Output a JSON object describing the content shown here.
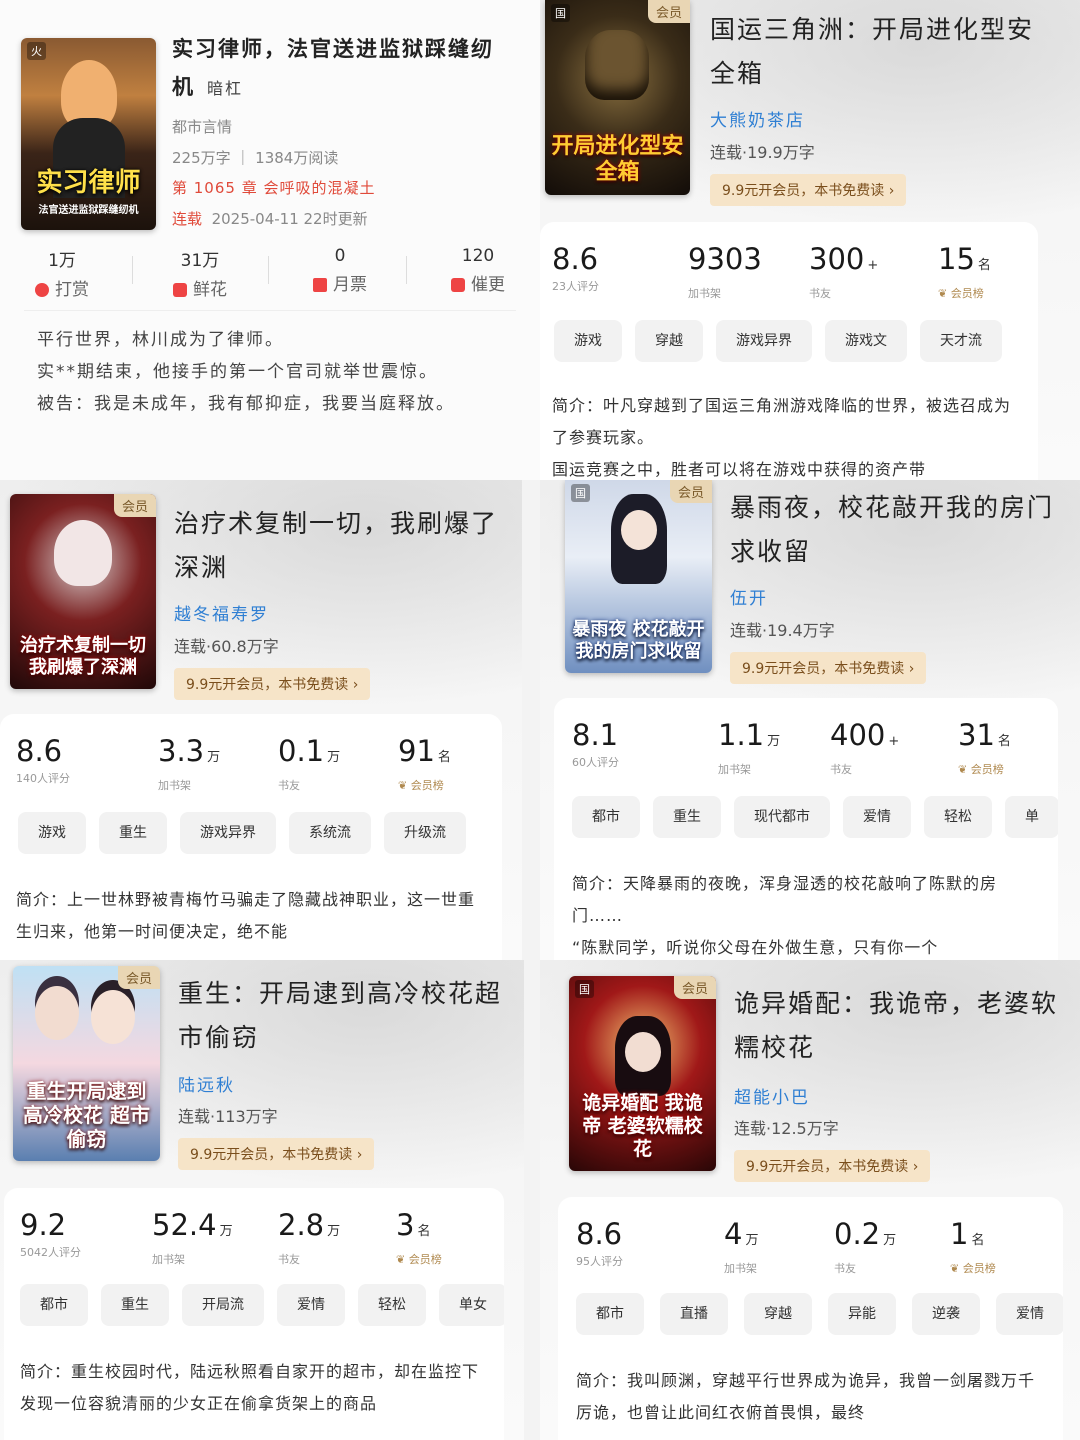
{
  "first": {
    "title": "实习律师，法官送进监狱踩缝纫机",
    "author": "暗杠",
    "genre": "都市言情",
    "words_reads": "225万字 ｜ 1384万阅读",
    "chapter": "第 1065 章 会呼吸的混凝土",
    "serial": "连载",
    "updated": "2025-04-11 22时更新",
    "cover_title": "实习律师",
    "cover_sub": "法官送进监狱踩缝纫机",
    "stats": [
      {
        "num": "1万",
        "label": "打赏"
      },
      {
        "num": "31万",
        "label": "鲜花"
      },
      {
        "num": "0",
        "label": "月票"
      },
      {
        "num": "120",
        "label": "催更"
      }
    ],
    "intro": [
      "平行世界，林川成为了律师。",
      "实**期结束，他接手的第一个官司就举世震惊。",
      "被告：我是未成年，我有郁抑症，我要当庭释放。"
    ]
  },
  "vip_label": "会员",
  "vip_button": "9.9元开会员，本书免费读",
  "rank_label": "会员榜",
  "intro_prefix": "简介：",
  "books": [
    {
      "title": "国运三角洲：开局进化型安全箱",
      "author": "大熊奶茶店",
      "meta": "连载·19.9万字",
      "cover_title": "开局进化型安全箱",
      "rating": "8.6",
      "rating_label": "23人评分",
      "shelf": "9303",
      "shelf_unit": "",
      "shelf_label": "加书架",
      "friends": "300",
      "friends_unit": "+",
      "friends_label": "书友",
      "rank": "15",
      "rank_unit": "名",
      "tags": [
        "游戏",
        "穿越",
        "游戏异界",
        "游戏文",
        "天才流"
      ],
      "intro": "叶凡穿越到了国运三角洲游戏降临的世界，被选召成为了参赛玩家。",
      "intro2": "国运竞赛之中，胜者可以将在游戏中获得的资产带"
    },
    {
      "title": "治疗术复制一切，我刷爆了深渊",
      "author": "越冬福寿罗",
      "meta": "连载·60.8万字",
      "cover_title": "治疗术复制一切我刷爆了深渊",
      "rating": "8.6",
      "rating_label": "140人评分",
      "shelf": "3.3",
      "shelf_unit": "万",
      "shelf_label": "加书架",
      "friends": "0.1",
      "friends_unit": "万",
      "friends_label": "书友",
      "rank": "91",
      "rank_unit": "名",
      "tags": [
        "游戏",
        "重生",
        "游戏异界",
        "系统流",
        "升级流"
      ],
      "intro": "上一世林野被青梅竹马骗走了隐藏战神职业，这一世重生归来，他第一时间便决定，绝不能",
      "intro2": ""
    },
    {
      "title": "暴雨夜，校花敲开我的房门求收留",
      "author": "伍开",
      "meta": "连载·19.4万字",
      "cover_title": "暴雨夜 校花敲开我的房门求收留",
      "rating": "8.1",
      "rating_label": "60人评分",
      "shelf": "1.1",
      "shelf_unit": "万",
      "shelf_label": "加书架",
      "friends": "400",
      "friends_unit": "+",
      "friends_label": "书友",
      "rank": "31",
      "rank_unit": "名",
      "tags": [
        "都市",
        "重生",
        "现代都市",
        "爱情",
        "轻松",
        "单"
      ],
      "intro": "天降暴雨的夜晚，浑身湿透的校花敲响了陈默的房门……",
      "intro2": "“陈默同学，听说你父母在外做生意，只有你一个"
    },
    {
      "title": "重生：开局逮到高冷校花超市偷窃",
      "author": "陆远秋",
      "meta": "连载·113万字",
      "cover_title": "重生开局逮到 高冷校花 超市偷窃",
      "rating": "9.2",
      "rating_label": "5042人评分",
      "shelf": "52.4",
      "shelf_unit": "万",
      "shelf_label": "加书架",
      "friends": "2.8",
      "friends_unit": "万",
      "friends_label": "书友",
      "rank": "3",
      "rank_unit": "名",
      "tags": [
        "都市",
        "重生",
        "开局流",
        "爱情",
        "轻松",
        "单女"
      ],
      "intro": "重生校园时代，陆远秋照看自家开的超市，却在监控下发现一位容貌清丽的少女正在偷拿货架",
      "intro2": "上的商品"
    },
    {
      "title": "诡异婚配：我诡帝，老婆软糯校花",
      "author": "超能小巴",
      "meta": "连载·12.5万字",
      "cover_title": "诡异婚配 我诡帝 老婆软糯校花",
      "rating": "8.6",
      "rating_label": "95人评分",
      "shelf": "4",
      "shelf_unit": "万",
      "shelf_label": "加书架",
      "friends": "0.2",
      "friends_unit": "万",
      "friends_label": "书友",
      "rank": "1",
      "rank_unit": "名",
      "tags": [
        "都市",
        "直播",
        "穿越",
        "异能",
        "逆袭",
        "爱情"
      ],
      "intro": "我叫顾渊，穿越平行世界成为诡异，我曾一剑屠戮万千厉诡，也曾让此间红衣俯首畏惧，最终",
      "intro2": ""
    }
  ]
}
